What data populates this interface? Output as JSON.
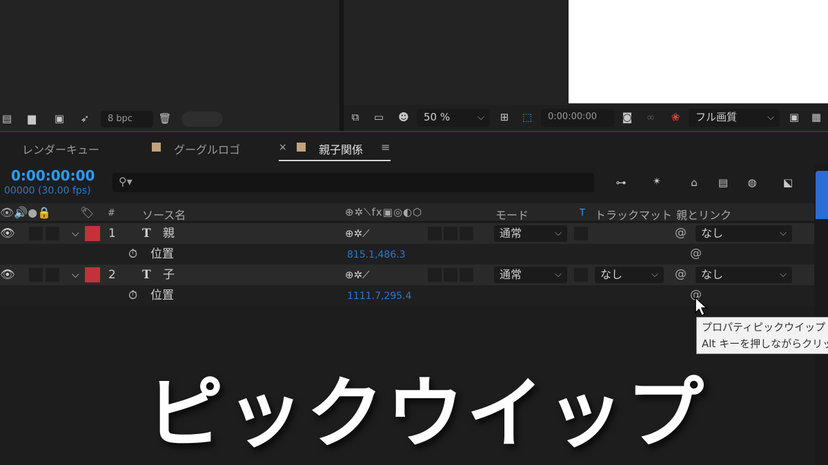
{
  "project_footer": {
    "bit_depth": "8 bpc",
    "icons": [
      "flowchart-icon",
      "folder-icon",
      "composition-icon",
      "render-icon",
      "trash-icon"
    ]
  },
  "viewer_bar": {
    "zoom": "50 %",
    "timecode": "0:00:00:00",
    "quality": "フル画質"
  },
  "tabs": [
    {
      "label": "レンダーキュー"
    },
    {
      "label": "グーグルロゴ"
    },
    {
      "label": "親子関係",
      "close": "×",
      "menu": "≡"
    }
  ],
  "timeline": {
    "current_time": "0:00:00:00",
    "frames": "00000 (30.00 fps)",
    "search_placeholder": "",
    "headers": {
      "number": "#",
      "source_name": "ソース名",
      "mode": "モード",
      "t": "T",
      "track_matte": "トラックマット",
      "parent_link": "親とリンク"
    },
    "layers": [
      {
        "number": "1",
        "type": "T",
        "name": "親",
        "mode": "通常",
        "track_matte": "",
        "parent": "なし",
        "property": {
          "name": "位置",
          "value": "815.1,486.3"
        }
      },
      {
        "number": "2",
        "type": "T",
        "name": "子",
        "mode": "通常",
        "track_matte": "なし",
        "parent": "なし",
        "property": {
          "name": "位置",
          "value": "1111.7,295.4"
        }
      }
    ]
  },
  "tooltip": {
    "line1": "プロパティピックウイップ (",
    "line2": "Alt キーを押しながらクリッ"
  },
  "caption": "ピックウイップ",
  "colors": {
    "accent_blue": "#2f9aff",
    "label_red": "#c4313a",
    "label_tan": "#c2a37c"
  }
}
